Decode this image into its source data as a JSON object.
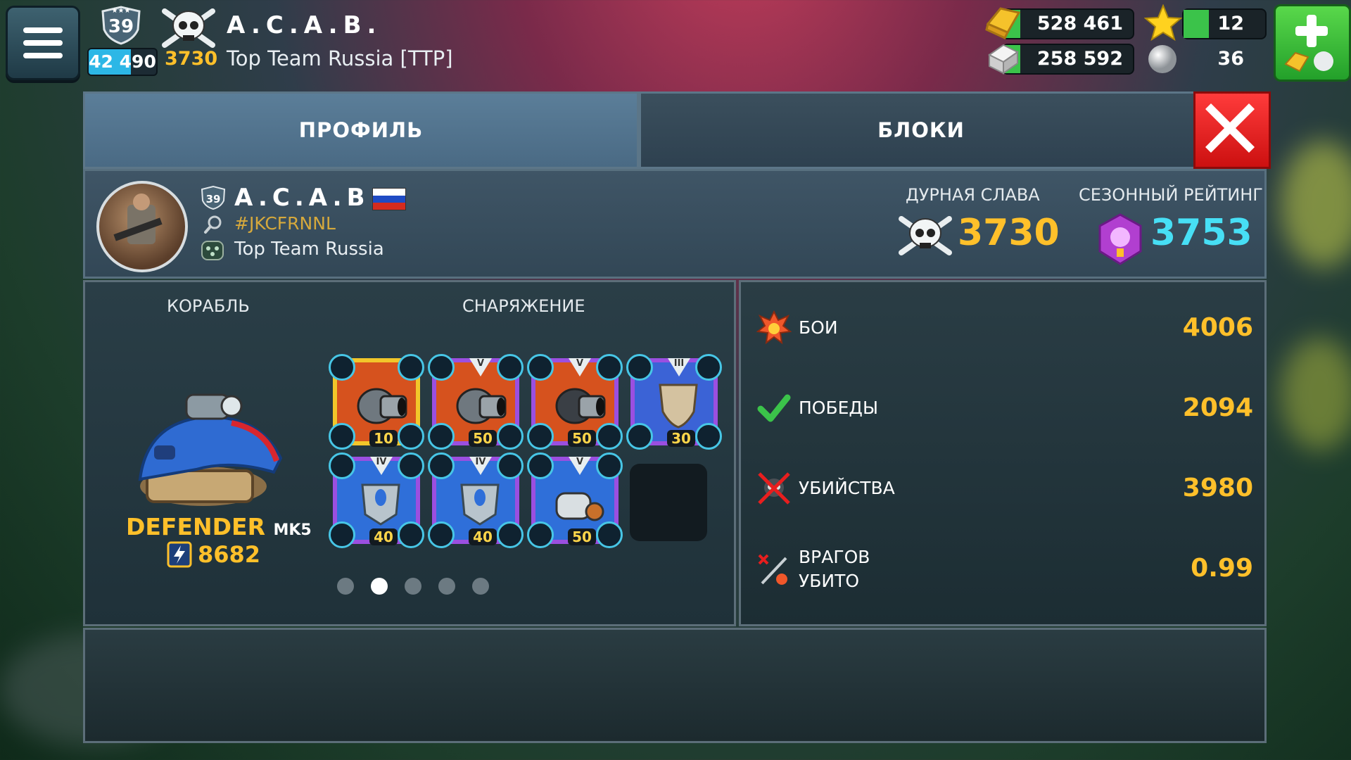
{
  "player": {
    "name": "A.C.A.B.",
    "level": "39",
    "xp": "42 490",
    "notoriety": "3730",
    "clan_full": "Top Team Russia [TTP]",
    "tag": "#JKCFRNNL",
    "clan": "Top Team Russia"
  },
  "resources": {
    "gold": "528 461",
    "cubes": "258 592",
    "stars": "12",
    "pearls": "36"
  },
  "tabs": {
    "profile": "ПРОФИЛЬ",
    "blocks": "БЛОКИ"
  },
  "header": {
    "notoriety_label": "ДУРНАЯ СЛАВА",
    "notoriety_value": "3730",
    "rating_label": "СЕЗОННЫЙ РЕЙТИНГ",
    "rating_value": "3753"
  },
  "loadout": {
    "ship_label": "КОРАБЛЬ",
    "gear_label": "СНАРЯЖЕНИЕ",
    "ship_name": "DEFENDER",
    "ship_mark": "MK5",
    "ship_power": "8682",
    "cards": [
      {
        "level": "10",
        "badge": "",
        "frame": "#f2c62a",
        "bg": "#d6521e",
        "type": "cannon"
      },
      {
        "level": "50",
        "badge": "V",
        "frame": "#9b4fe0",
        "bg": "#d6521e",
        "type": "cannon"
      },
      {
        "level": "50",
        "badge": "V",
        "frame": "#9b4fe0",
        "bg": "#d6521e",
        "type": "cannon-dark"
      },
      {
        "level": "30",
        "badge": "III",
        "frame": "#9b4fe0",
        "bg": "#3b63d6",
        "type": "shield"
      },
      {
        "level": "40",
        "badge": "IV",
        "frame": "#9b4fe0",
        "bg": "#2f6fd9",
        "type": "armor"
      },
      {
        "level": "40",
        "badge": "IV",
        "frame": "#9b4fe0",
        "bg": "#2f6fd9",
        "type": "armor"
      },
      {
        "level": "50",
        "badge": "V",
        "frame": "#9b4fe0",
        "bg": "#2f6fd9",
        "type": "engine"
      }
    ],
    "pages": 5,
    "active_page": 1
  },
  "stats": [
    {
      "label": "БОИ",
      "value": "4006",
      "icon": "explosion-icon"
    },
    {
      "label": "ПОБЕДЫ",
      "value": "2094",
      "icon": "checkmark-icon"
    },
    {
      "label": "УБИЙСТВА",
      "value": "3980",
      "icon": "crossed-skull-icon"
    },
    {
      "label_line1": "ВРАГОВ",
      "label_line2": "УБИТО",
      "value": "0.99",
      "icon": "ratio-icon"
    }
  ],
  "colors": {
    "gold": "#ffc02a",
    "cyan": "#47dff5",
    "green": "#3bc34a",
    "red": "#e81e1e"
  }
}
